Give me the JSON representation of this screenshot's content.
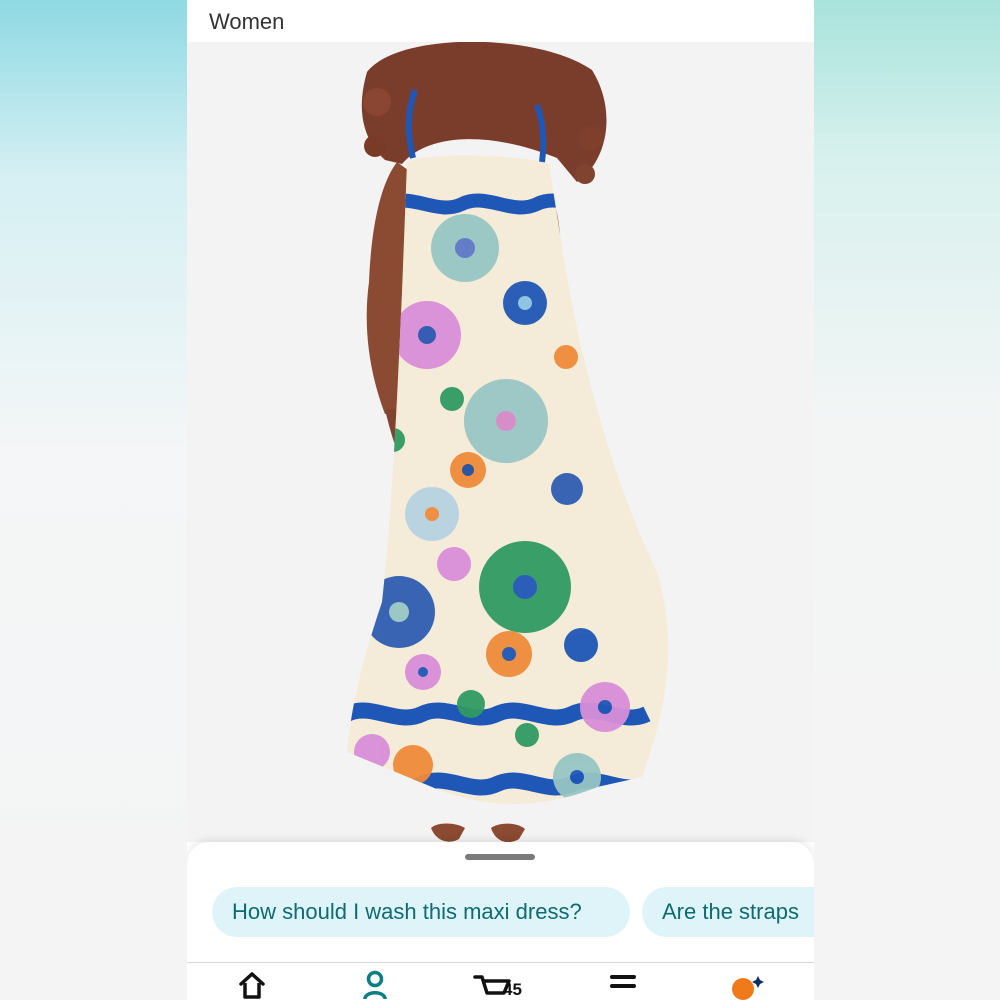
{
  "product": {
    "title_partial": "page with top strip cut off",
    "title_line2": "Women"
  },
  "suggestions": [
    {
      "label": "How should I wash this maxi dress?"
    },
    {
      "label": "Are the straps"
    }
  ],
  "nav": {
    "cart_count": "45"
  },
  "colors": {
    "chip_bg": "#dff4f8",
    "chip_text": "#0d6b73",
    "accent_orange": "#f07a1a"
  },
  "icons": [
    "home-icon",
    "account-icon",
    "cart-icon",
    "menu-icon",
    "assistant-icon"
  ]
}
